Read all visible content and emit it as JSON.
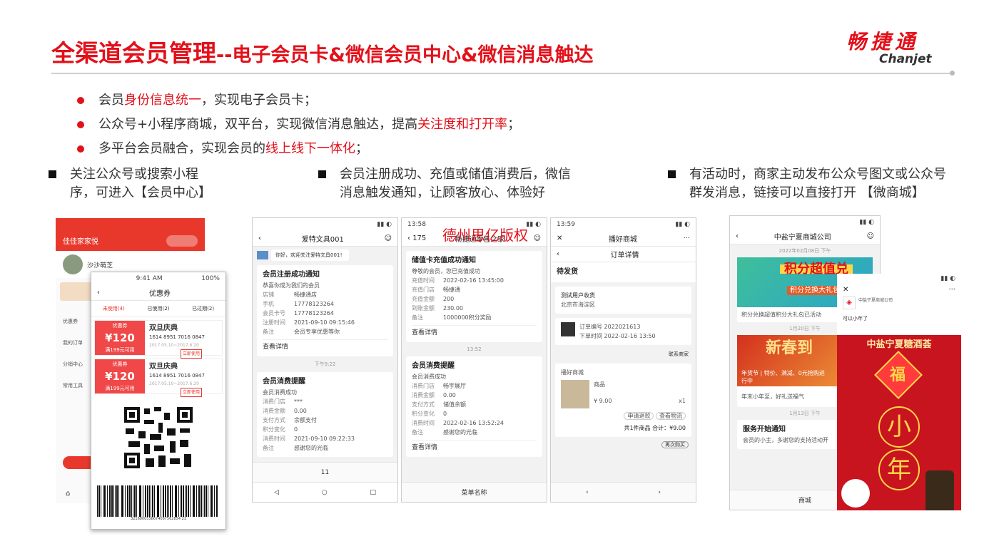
{
  "title": {
    "main": "全渠道会员管理",
    "sub": "--电子会员卡&微信会员中心&微信消息触达"
  },
  "logo": {
    "cn": "畅捷通",
    "en": "Chanjet"
  },
  "bullets": [
    {
      "pre": "会员",
      "hl": "身份信息统一",
      "post": "，实现电子会员卡；"
    },
    {
      "pre": "公众号+小程序商城，双平台，实现微信消息触达，提高",
      "hl": "关注度和打开率",
      "post": "；"
    },
    {
      "pre": "多平台会员融合，实现会员的",
      "hl": "线上线下一体化",
      "post": "；"
    }
  ],
  "columns": [
    {
      "line1": "关注公众号或搜索小程",
      "line2": "序，可进入【会员中心】"
    },
    {
      "line1": "会员注册成功、充值或储值消费后，微信",
      "line2": "消息触发通知，让顾客放心、体验好"
    },
    {
      "line1": "有活动时，商家主动发布公众号图文或公众号",
      "line2": "群发消息，链接可以直接打开 【微商城】"
    }
  ],
  "watermark": "德州思亿版权",
  "member_center": {
    "shop": "佳佳家家悦",
    "user": "沙沙萌芝",
    "menu": [
      "优惠券",
      "我的订单",
      "分销中心",
      "常用工具"
    ],
    "coupon_page": {
      "time": "9:41 AM",
      "battery": "100%",
      "title": "优惠券",
      "tabs": [
        "未使用(4)",
        "已使用(2)",
        "已过期(2)"
      ],
      "coupons": [
        {
          "label": "优惠券",
          "amount": "¥120",
          "cond": "满199元可用",
          "name": "双旦庆典",
          "code": "1614 8951 7016 0847",
          "date": "2017.05.10~2017.6.20",
          "btn": "立即使用"
        },
        {
          "label": "优惠券",
          "amount": "¥120",
          "cond": "满199元可用",
          "name": "双旦庆典",
          "code": "1614 8951 7016 0847",
          "date": "2017.05.10~2017.6.20",
          "btn": "立即使用"
        }
      ],
      "barcode_num": "3216800558674087562854 21"
    }
  },
  "phone_a": {
    "time": "",
    "title": "爱特文具001",
    "greeting": "你好，欢迎关注爱特文具001！",
    "cards": [
      {
        "head": "会员注册成功通知",
        "desc": "恭喜你成为我们的会员",
        "rows": [
          [
            "店铺",
            "畅捷通店"
          ],
          [
            "手机",
            "17778123264"
          ],
          [
            "会员卡号",
            "17778123264"
          ],
          [
            "注册时间",
            "2021-09-10 09:15:46"
          ],
          [
            "备注",
            "会员专享优惠等你"
          ]
        ],
        "more": "查看详情"
      },
      {
        "head": "会员消费提醒",
        "desc": "会员消费成功",
        "rows": [
          [
            "消费门店",
            "***"
          ],
          [
            "消费金额",
            "0.00"
          ],
          [
            "支付方式",
            "余额支付"
          ],
          [
            "积分变化",
            "0"
          ],
          [
            "消费时间",
            "2021-09-10 09:22:33"
          ],
          [
            "备注",
            "感谢您的光临"
          ]
        ],
        "more": ""
      }
    ],
    "date": "下午9:22",
    "bottom": "11"
  },
  "phone_b": {
    "time": "13:58",
    "back": "175",
    "title": "畅捷通零售之家",
    "cards": [
      {
        "head": "储值卡充值成功通知",
        "desc": "尊敬的会员，您已充值成功",
        "rows": [
          [
            "充值时间",
            "2022-02-16 13:45:00"
          ],
          [
            "充值门店",
            "畅捷通"
          ],
          [
            "充值金额",
            "200"
          ],
          [
            "到账金额",
            "230.00"
          ],
          [
            "备注",
            "1000000积分奖励"
          ]
        ],
        "more": "查看详情"
      },
      {
        "head": "会员消费提醒",
        "desc": "会员消费成功",
        "rows": [
          [
            "消费门店",
            "畅宇展厅"
          ],
          [
            "消费金额",
            "0.00"
          ],
          [
            "支付方式",
            "储值余额"
          ],
          [
            "积分变化",
            "0"
          ],
          [
            "消费时间",
            "2022-02-16 13:52:24"
          ],
          [
            "备注",
            "感谢您的光临"
          ]
        ],
        "more": "查看详情"
      }
    ],
    "date": "13:52",
    "bottom": "菜单名称"
  },
  "phone_c": {
    "time": "13:59",
    "title": "播好商城",
    "sub": "订单详情",
    "status": "待发货",
    "addr_name": "测试用户收货",
    "addr_detail": "北京市海淀区",
    "order_no": "订单编号 2022021613",
    "order_time": "下单时间 2022-02-16 13:50",
    "contact": "联系商家",
    "shop": "播好商城",
    "goods": "商品",
    "price": "¥ 9.00",
    "qty": "x1",
    "btn1": "申请退款",
    "btn2": "查看物流",
    "total": "共1件商品 合计：¥9.00",
    "btn3": "再次购买"
  },
  "phone_d": {
    "title": "中盐宁夏商城公司",
    "date1": "2022年02月08日 下午",
    "banner1": "积分超值兑",
    "banner1_sub": "积分兑换大礼包",
    "caption1": "积分兑换超值积分大礼包已活动",
    "date2": "1月20日 下午",
    "banner2": "新春到",
    "caption2": "年货节 | 特价、满减、0元抢购进行中",
    "sub2": "年末小年至，好礼送福气",
    "date3": "1月13日 下午",
    "card3_title": "服务开始通知",
    "card3_text": "会员的小主，多谢您的支持活动开",
    "bottom": "商城",
    "poster_time": "",
    "poster_company": "中盐宁夏商城公司",
    "poster_msg": "可以小年了",
    "poster_title": "中盐宁夏糖酒荟",
    "poster_big1": "小",
    "poster_big2": "年",
    "poster_fu": "福"
  }
}
